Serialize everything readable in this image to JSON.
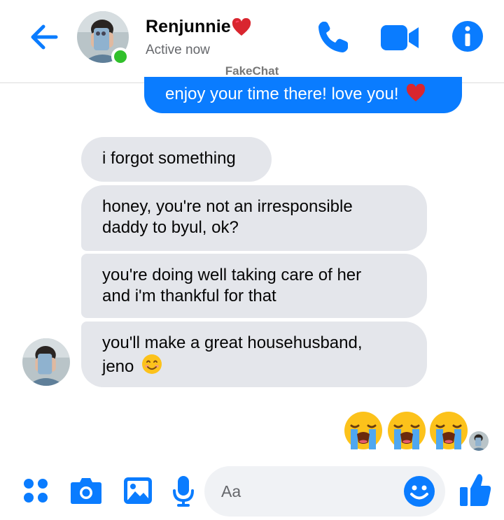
{
  "header": {
    "contact_name": "Renjunnie",
    "status": "Active now",
    "watermark": "FakeChat",
    "icons": [
      "back-arrow-icon",
      "phone-icon",
      "video-camera-icon",
      "info-icon",
      "heart-emoji"
    ]
  },
  "messages": [
    {
      "direction": "outgoing",
      "text": "enjoy your time there! love you!",
      "emoji": "red-heart"
    },
    {
      "direction": "incoming",
      "text": "i forgot something"
    },
    {
      "direction": "incoming",
      "lines": [
        "honey, you're not an irresponsible",
        "daddy to byul, ok?"
      ]
    },
    {
      "direction": "incoming",
      "lines": [
        "you're doing well taking care of her",
        "and i'm thankful for that"
      ]
    },
    {
      "direction": "incoming",
      "lines": [
        "you'll make a great househusband,",
        "jeno"
      ],
      "emoji": "smiling-face"
    },
    {
      "direction": "outgoing",
      "emoji_only": [
        "loudly-crying-face",
        "loudly-crying-face",
        "loudly-crying-face"
      ]
    }
  ],
  "composer": {
    "placeholder": "Aa",
    "icons": [
      "apps-icon",
      "camera-icon",
      "gallery-icon",
      "microphone-icon",
      "emoji-icon",
      "thumbs-up-icon"
    ]
  },
  "colors": {
    "accent": "#0a7cff",
    "incoming_bubble": "#e4e6eb",
    "online": "#31c02b",
    "secondary_text": "#65676b"
  }
}
